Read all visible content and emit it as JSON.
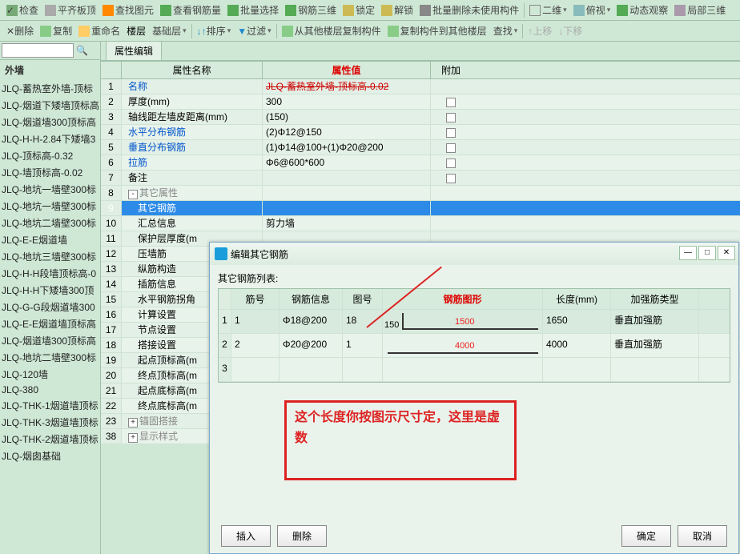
{
  "toolbar1": {
    "check": "检查",
    "align": "平齐板顶",
    "findU": "查找图元",
    "viewRebar": "查看钢筋量",
    "batchSel": "批量选择",
    "rebar3D": "钢筋三维",
    "lock": "锁定",
    "unlock": "解锁",
    "batchDel": "批量删除未使用构件",
    "viewMode": "二维",
    "top": "俯视",
    "dynamic": "动态观察",
    "local3D": "局部三维"
  },
  "toolbar2": {
    "delete": "删除",
    "copy": "复制",
    "rename": "重命名",
    "floorLbl": "楼层",
    "floor": "基础层",
    "sort": "排序",
    "filter": "过滤",
    "copyFrom": "从其他楼层复制构件",
    "copyTo": "复制构件到其他楼层",
    "find": "查找",
    "up": "上移",
    "down": "下移"
  },
  "sidebar": {
    "head": "外墙",
    "items": [
      "JLQ-蓄热室外墙-顶标",
      "JLQ-烟道下矮墙顶标高",
      "JLQ-烟道墙300顶标高",
      "JLQ-H-H-2.84下矮墙3",
      "JLQ-顶标高-0.32",
      "JLQ-墙顶标高-0.02",
      "JLQ-地坑一墙壁300标",
      "JLQ-地坑一墙壁300标",
      "JLQ-地坑二墙壁300标",
      "JLQ-E-E烟道墙",
      "JLQ-地坑三墙壁300标",
      "JLQ-H-H段墙顶标高-0",
      "JLQ-H-H下矮墙300顶",
      "JLQ-G-G段烟道墙300",
      "JLQ-E-E烟道墙顶标高",
      "JLQ-烟道墙300顶标高",
      "JLQ-地坑二墙壁300标",
      "JLQ-120墙",
      "JLQ-380",
      "JLQ-THK-1烟道墙顶标",
      "JLQ-THK-3烟道墙顶标",
      "JLQ-THK-2烟道墙顶标",
      "JLQ-烟囱基础"
    ]
  },
  "tab": "属性编辑",
  "colName": "属性名称",
  "colVal": "属性值",
  "colAdd": "附加",
  "rows": [
    {
      "i": "1",
      "n": "名称",
      "v": "JLQ-蓄热室外墙-顶标高-0.02",
      "blue": true,
      "strike": true
    },
    {
      "i": "2",
      "n": "厚度(mm)",
      "v": "300",
      "cb": true
    },
    {
      "i": "3",
      "n": "轴线距左墙皮距离(mm)",
      "v": "(150)",
      "cb": true
    },
    {
      "i": "4",
      "n": "水平分布钢筋",
      "v": "(2)Φ12@150",
      "blue": true,
      "cb": true
    },
    {
      "i": "5",
      "n": "垂直分布钢筋",
      "v": "(1)Φ14@100+(1)Φ20@200",
      "blue": true,
      "cb": true
    },
    {
      "i": "6",
      "n": "拉筋",
      "v": "Φ6@600*600",
      "blue": true,
      "cb": true
    },
    {
      "i": "7",
      "n": "备注",
      "v": "",
      "cb": true
    },
    {
      "i": "8",
      "n": "其它属性",
      "v": "",
      "grey": true,
      "exp": "-"
    },
    {
      "i": "9",
      "n": "其它钢筋",
      "v": "",
      "sel": true,
      "indent": true
    },
    {
      "i": "10",
      "n": "汇总信息",
      "v": "剪力墙",
      "indent": true
    },
    {
      "i": "11",
      "n": "保护层厚度(m",
      "v": "",
      "indent": true
    },
    {
      "i": "12",
      "n": "压墙筋",
      "v": "",
      "indent": true
    },
    {
      "i": "13",
      "n": "纵筋构造",
      "v": "",
      "indent": true
    },
    {
      "i": "14",
      "n": "插筋信息",
      "v": "",
      "indent": true
    },
    {
      "i": "15",
      "n": "水平钢筋拐角",
      "v": "",
      "indent": true
    },
    {
      "i": "16",
      "n": "计算设置",
      "v": "",
      "indent": true
    },
    {
      "i": "17",
      "n": "节点设置",
      "v": "",
      "indent": true
    },
    {
      "i": "18",
      "n": "搭接设置",
      "v": "",
      "indent": true
    },
    {
      "i": "19",
      "n": "起点顶标高(m",
      "v": "",
      "indent": true
    },
    {
      "i": "20",
      "n": "终点顶标高(m",
      "v": "",
      "indent": true
    },
    {
      "i": "21",
      "n": "起点底标高(m",
      "v": "",
      "indent": true
    },
    {
      "i": "22",
      "n": "终点底标高(m",
      "v": "",
      "indent": true
    },
    {
      "i": "23",
      "n": "锚固搭接",
      "v": "",
      "grey": true,
      "exp": "+"
    },
    {
      "i": "38",
      "n": "显示样式",
      "v": "",
      "grey": true,
      "exp": "+"
    }
  ],
  "dialog": {
    "title": "编辑其它钢筋",
    "listLabel": "其它钢筋列表:",
    "cols": [
      "筋号",
      "钢筋信息",
      "图号",
      "钢筋图形",
      "长度(mm)",
      "加强筋类型"
    ],
    "rows": [
      {
        "i": "1",
        "c1": "1",
        "c2": "Φ18@200",
        "c3": "18",
        "left": "150",
        "red": "1500",
        "len": "1650",
        "type": "垂直加强筋"
      },
      {
        "i": "2",
        "c1": "2",
        "c2": "Φ20@200",
        "c3": "1",
        "left": "",
        "red": "4000",
        "len": "4000",
        "type": "垂直加强筋"
      },
      {
        "i": "3",
        "c1": "",
        "c2": "",
        "c3": "",
        "left": "",
        "red": "",
        "len": "",
        "type": ""
      }
    ],
    "insert": "插入",
    "delete": "删除",
    "ok": "确定",
    "cancel": "取消"
  },
  "callout": "这个长度你按图示尺寸定，这里是虚数"
}
